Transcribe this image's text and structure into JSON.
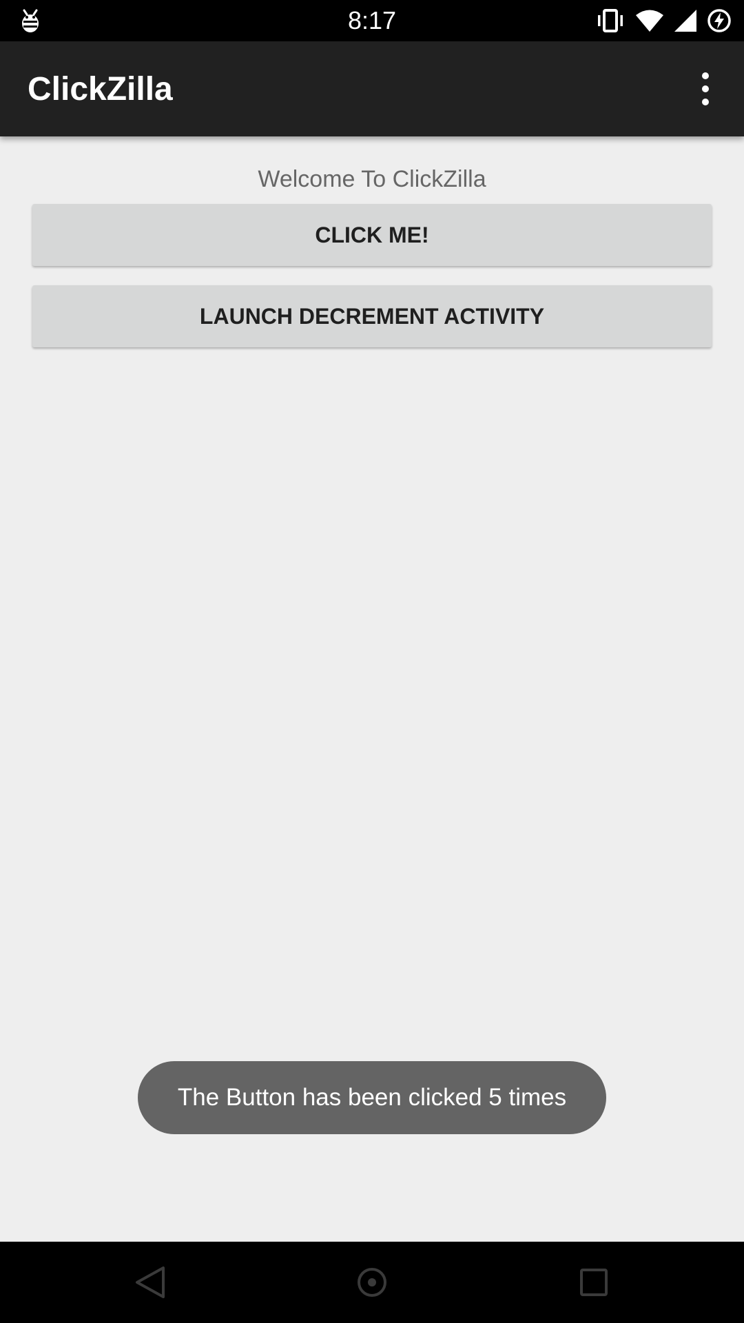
{
  "status_bar": {
    "time": "8:17",
    "icons": [
      "debug-bug-icon",
      "vibrate-icon",
      "wifi-icon",
      "cell-signal-icon",
      "battery-charging-icon"
    ]
  },
  "app_bar": {
    "title": "ClickZilla",
    "overflow_icon": "more-vert-icon"
  },
  "main": {
    "welcome": "Welcome To ClickZilla",
    "click_button_label": "CLICK ME!",
    "launch_button_label": "LAUNCH DECREMENT ACTIVITY"
  },
  "toast": {
    "message": "The Button has been clicked 5 times"
  },
  "nav_bar": {
    "icons": [
      "back-icon",
      "home-icon",
      "recents-icon"
    ]
  },
  "colors": {
    "app_bar": "#212121",
    "background": "#eeeeee",
    "button": "#d6d7d7",
    "toast": "#646464"
  }
}
